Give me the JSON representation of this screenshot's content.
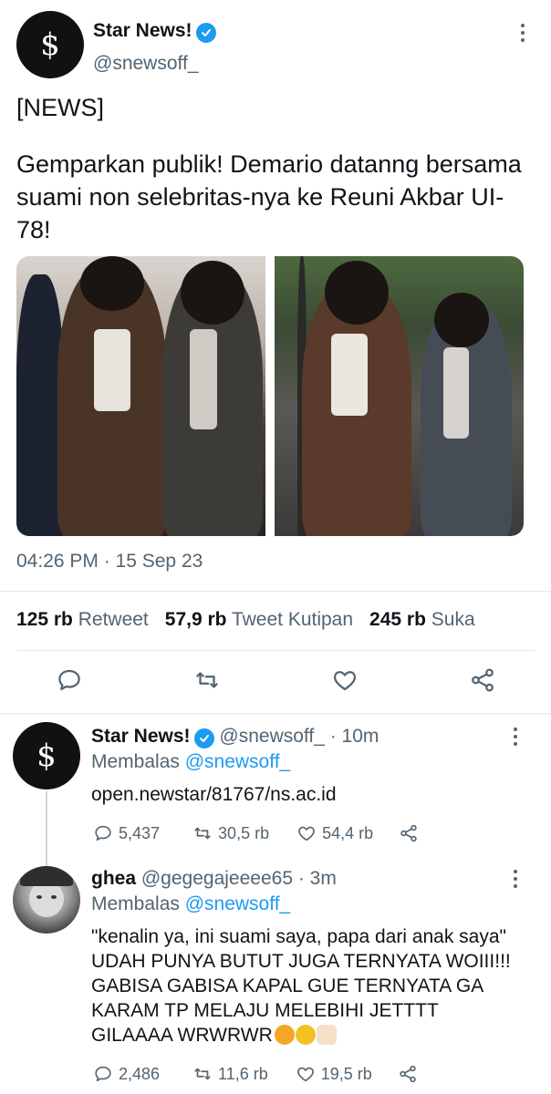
{
  "main_tweet": {
    "author_name": "Star News!",
    "author_handle": "@snewsoff_",
    "tag": "[NEWS]",
    "text": "Gemparkan publik! Demario datanng bersama suami non selebritas-nya ke Reuni Akbar UI-78!",
    "timestamp": "04:26 PM · 15 Sep 23",
    "stats": {
      "retweets_num": "125 rb",
      "retweets_label": "Retweet",
      "quotes_num": "57,9 rb",
      "quotes_label": "Tweet Kutipan",
      "likes_num": "245 rb",
      "likes_label": "Suka"
    }
  },
  "replies": [
    {
      "name": "Star News!",
      "handle": "@snewsoff_",
      "time": "· 10m",
      "replying_to_label": "Membalas",
      "replying_to_handle": "@snewsoff_",
      "body": "open.newstar/81767/ns.ac.id",
      "replies_count": "5,437",
      "retweets_count": "30,5 rb",
      "likes_count": "54,4 rb"
    },
    {
      "name": "ghea",
      "handle": "@gegegajeeee65",
      "time": "· 3m",
      "replying_to_label": "Membalas",
      "replying_to_handle": "@snewsoff_",
      "body": "\"kenalin ya, ini suami saya, papa dari anak saya\" UDAH PUNYA BUTUT JUGA TERNYATA WOIII!!! GABISA GABISA KAPAL GUE TERNYATA GA KARAM TP MELAJU MELEBIHI JETTTT GILAAAA WRWRWR",
      "replies_count": "2,486",
      "retweets_count": "11,6 rb",
      "likes_count": "19,5 rb"
    }
  ],
  "colors": {
    "accent": "#1d9bf0",
    "secondary_text": "#536471",
    "primary_text": "#0f1419"
  },
  "icons": [
    "verified-badge-icon",
    "more-options-icon",
    "reply-icon",
    "retweet-icon",
    "like-icon",
    "share-icon"
  ]
}
